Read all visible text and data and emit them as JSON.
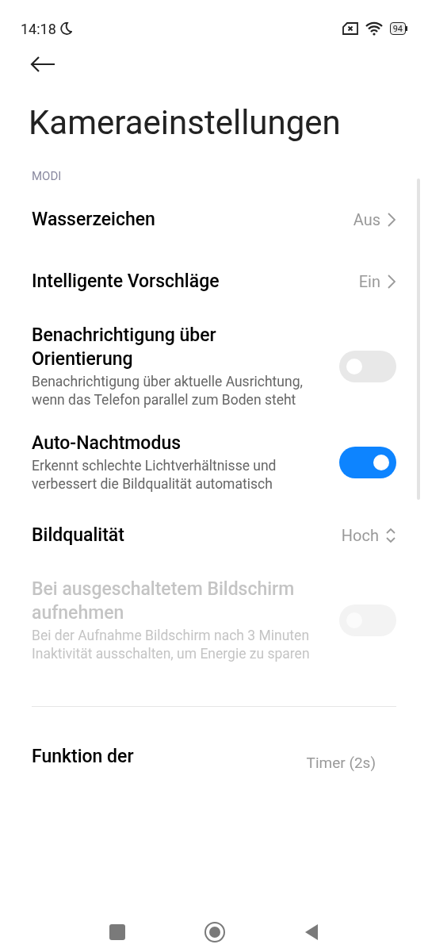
{
  "status_bar": {
    "time": "14:18",
    "battery": "94"
  },
  "title": "Kameraeinstellungen",
  "section": "MODI",
  "settings": [
    {
      "kind": "link",
      "title": "Wasserzeichen",
      "value": "Aus",
      "disabled": false
    },
    {
      "kind": "link",
      "title": "Intelligente Vorschläge",
      "value": "Ein",
      "disabled": false
    },
    {
      "kind": "toggle",
      "title": "Benachrichtigung über Orientierung",
      "description": "Benachrichtigung über aktuelle Ausrichtung, wenn das Telefon parallel zum Boden steht",
      "on": false,
      "disabled": false
    },
    {
      "kind": "toggle",
      "title": "Auto-Nachtmodus",
      "description": "Erkennt schlechte Lichtverhältnisse und verbessert die Bildqualität automatisch",
      "on": true,
      "disabled": false
    },
    {
      "kind": "select",
      "title": "Bildqualität",
      "value": "Hoch",
      "disabled": false
    },
    {
      "kind": "toggle",
      "title": "Bei ausgeschaltetem Bildschirm aufnehmen",
      "description": "Bei der Aufnahme Bildschirm nach 3 Minuten Inaktivität ausschalten, um Energie zu sparen",
      "on": false,
      "disabled": true
    }
  ],
  "last_setting": {
    "title": "Funktion der",
    "value": "Timer (2s)"
  }
}
